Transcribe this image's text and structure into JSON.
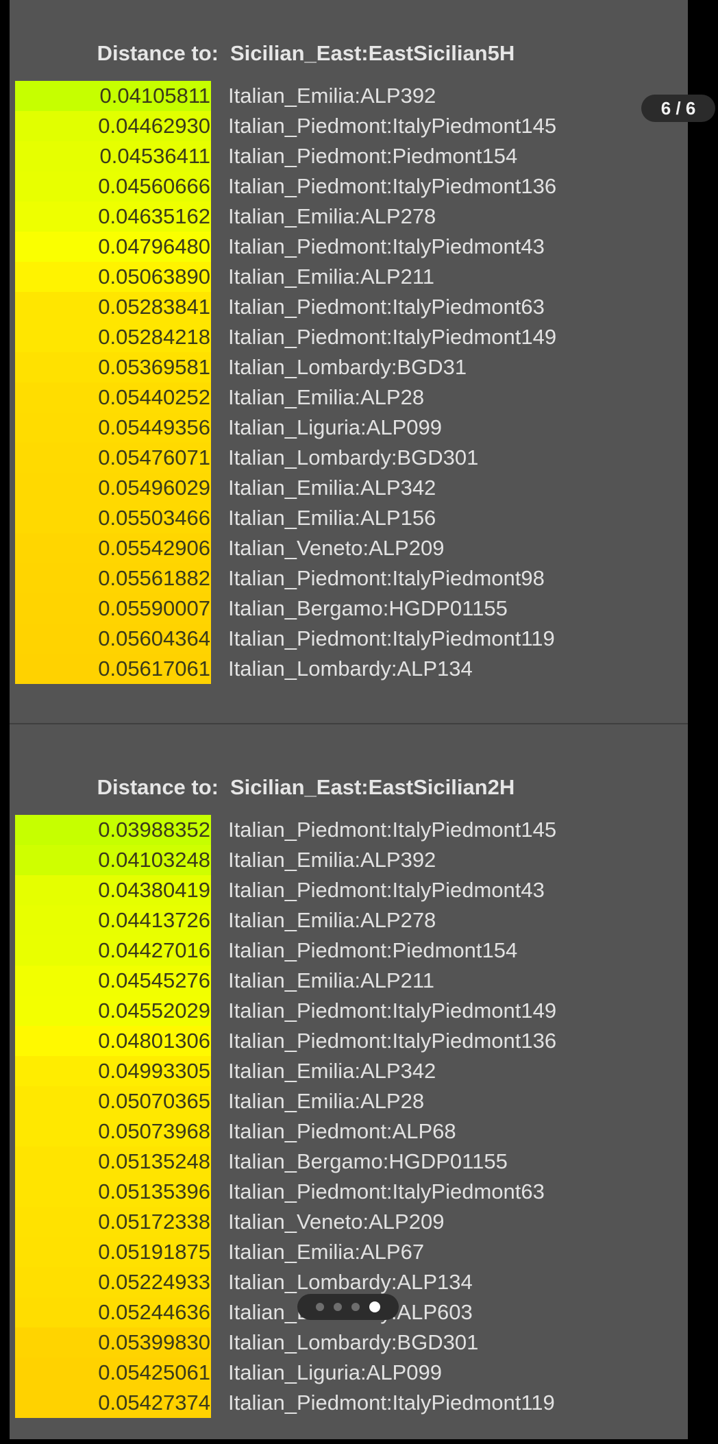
{
  "page_counter": "6 / 6",
  "pagination": {
    "count": 4,
    "active": 3
  },
  "colors": {
    "scale_low": "#c6ff00",
    "scale_mid": "#ffff00",
    "scale_high": "#ffd200",
    "panel_bg": "#545454"
  },
  "sections": [
    {
      "label": "Distance to:",
      "target": "Sicilian_East:EastSicilian5H",
      "rows": [
        {
          "value": "0.04105811",
          "label": "Italian_Emilia:ALP392"
        },
        {
          "value": "0.04462930",
          "label": "Italian_Piedmont:ItalyPiedmont145"
        },
        {
          "value": "0.04536411",
          "label": "Italian_Piedmont:Piedmont154"
        },
        {
          "value": "0.04560666",
          "label": "Italian_Piedmont:ItalyPiedmont136"
        },
        {
          "value": "0.04635162",
          "label": "Italian_Emilia:ALP278"
        },
        {
          "value": "0.04796480",
          "label": "Italian_Piedmont:ItalyPiedmont43"
        },
        {
          "value": "0.05063890",
          "label": "Italian_Emilia:ALP211"
        },
        {
          "value": "0.05283841",
          "label": "Italian_Piedmont:ItalyPiedmont63"
        },
        {
          "value": "0.05284218",
          "label": "Italian_Piedmont:ItalyPiedmont149"
        },
        {
          "value": "0.05369581",
          "label": "Italian_Lombardy:BGD31"
        },
        {
          "value": "0.05440252",
          "label": "Italian_Emilia:ALP28"
        },
        {
          "value": "0.05449356",
          "label": "Italian_Liguria:ALP099"
        },
        {
          "value": "0.05476071",
          "label": "Italian_Lombardy:BGD301"
        },
        {
          "value": "0.05496029",
          "label": "Italian_Emilia:ALP342"
        },
        {
          "value": "0.05503466",
          "label": "Italian_Emilia:ALP156"
        },
        {
          "value": "0.05542906",
          "label": "Italian_Veneto:ALP209"
        },
        {
          "value": "0.05561882",
          "label": "Italian_Piedmont:ItalyPiedmont98"
        },
        {
          "value": "0.05590007",
          "label": "Italian_Bergamo:HGDP01155"
        },
        {
          "value": "0.05604364",
          "label": "Italian_Piedmont:ItalyPiedmont119"
        },
        {
          "value": "0.05617061",
          "label": "Italian_Lombardy:ALP134"
        }
      ]
    },
    {
      "label": "Distance to:",
      "target": "Sicilian_East:EastSicilian2H",
      "rows": [
        {
          "value": "0.03988352",
          "label": "Italian_Piedmont:ItalyPiedmont145"
        },
        {
          "value": "0.04103248",
          "label": "Italian_Emilia:ALP392"
        },
        {
          "value": "0.04380419",
          "label": "Italian_Piedmont:ItalyPiedmont43"
        },
        {
          "value": "0.04413726",
          "label": "Italian_Emilia:ALP278"
        },
        {
          "value": "0.04427016",
          "label": "Italian_Piedmont:Piedmont154"
        },
        {
          "value": "0.04545276",
          "label": "Italian_Emilia:ALP211"
        },
        {
          "value": "0.04552029",
          "label": "Italian_Piedmont:ItalyPiedmont149"
        },
        {
          "value": "0.04801306",
          "label": "Italian_Piedmont:ItalyPiedmont136"
        },
        {
          "value": "0.04993305",
          "label": "Italian_Emilia:ALP342"
        },
        {
          "value": "0.05070365",
          "label": "Italian_Emilia:ALP28"
        },
        {
          "value": "0.05073968",
          "label": "Italian_Piedmont:ALP68"
        },
        {
          "value": "0.05135248",
          "label": "Italian_Bergamo:HGDP01155"
        },
        {
          "value": "0.05135396",
          "label": "Italian_Piedmont:ItalyPiedmont63"
        },
        {
          "value": "0.05172338",
          "label": "Italian_Veneto:ALP209"
        },
        {
          "value": "0.05191875",
          "label": "Italian_Emilia:ALP67"
        },
        {
          "value": "0.05224933",
          "label": "Italian_Lombardy:ALP134"
        },
        {
          "value": "0.05244636",
          "label": "Italian_Lombardy:ALP603"
        },
        {
          "value": "0.05399830",
          "label": "Italian_Lombardy:BGD301"
        },
        {
          "value": "0.05425061",
          "label": "Italian_Liguria:ALP099"
        },
        {
          "value": "0.05427374",
          "label": "Italian_Piedmont:ItalyPiedmont119"
        }
      ]
    }
  ]
}
